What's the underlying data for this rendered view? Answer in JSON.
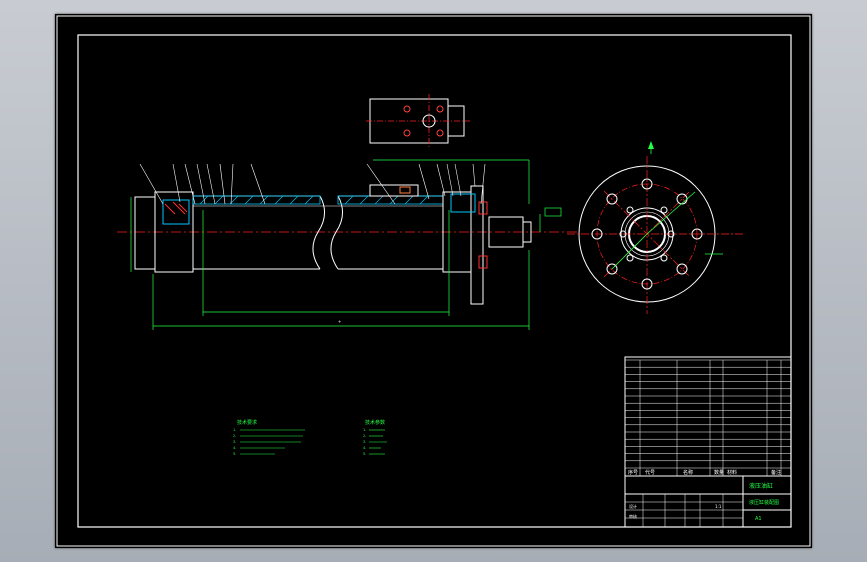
{
  "drawing": {
    "colors": {
      "background": "#000000",
      "outline": "#ffffff",
      "hatch": "#00c8ff",
      "centerline": "#ff2020",
      "dimension": "#22ff44",
      "text": "#ffffff"
    },
    "tech_notes_left": {
      "title": "技术要求",
      "lines": [
        "1.",
        "2.",
        "3.",
        "4.",
        "5."
      ]
    },
    "tech_notes_right": {
      "title": "技术参数",
      "lines": [
        "1.",
        "2.",
        "3.",
        "4.",
        "5."
      ]
    }
  },
  "title_block": {
    "bom_header": [
      "序号",
      "代号",
      "名称",
      "数量",
      "材料",
      "备注"
    ],
    "bom_row_count": 15,
    "designer_label": "设计",
    "checker_label": "审核",
    "title": "液压油缸",
    "drawing_name": "液压缸装配图",
    "scale": "1:1",
    "sheet": "A1"
  }
}
